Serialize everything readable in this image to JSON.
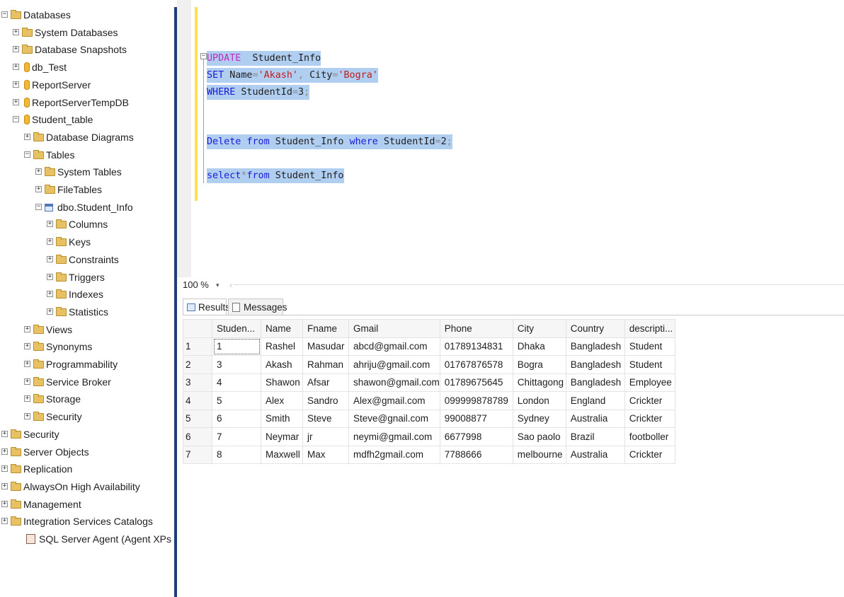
{
  "tree": [
    {
      "label": "Databases",
      "icon": "folder",
      "exp": "−"
    },
    {
      "label": "System Databases",
      "icon": "folder",
      "exp": "+"
    },
    {
      "label": "Database Snapshots",
      "icon": "folder",
      "exp": "+"
    },
    {
      "label": "db_Test",
      "icon": "database",
      "exp": "+"
    },
    {
      "label": "ReportServer",
      "icon": "database",
      "exp": "+"
    },
    {
      "label": "ReportServerTempDB",
      "icon": "database",
      "exp": "+"
    },
    {
      "label": "Student_table",
      "icon": "database",
      "exp": "−"
    },
    {
      "label": "Database Diagrams",
      "icon": "folder",
      "exp": "+"
    },
    {
      "label": "Tables",
      "icon": "folder",
      "exp": "−"
    },
    {
      "label": "System Tables",
      "icon": "folder",
      "exp": "+"
    },
    {
      "label": "FileTables",
      "icon": "folder",
      "exp": "+"
    },
    {
      "label": "dbo.Student_Info",
      "icon": "table",
      "exp": "−"
    },
    {
      "label": "Columns",
      "icon": "folder",
      "exp": "+"
    },
    {
      "label": "Keys",
      "icon": "folder",
      "exp": "+"
    },
    {
      "label": "Constraints",
      "icon": "folder",
      "exp": "+"
    },
    {
      "label": "Triggers",
      "icon": "folder",
      "exp": "+"
    },
    {
      "label": "Indexes",
      "icon": "folder",
      "exp": "+"
    },
    {
      "label": "Statistics",
      "icon": "folder",
      "exp": "+"
    },
    {
      "label": "Views",
      "icon": "folder",
      "exp": "+"
    },
    {
      "label": "Synonyms",
      "icon": "folder",
      "exp": "+"
    },
    {
      "label": "Programmability",
      "icon": "folder",
      "exp": "+"
    },
    {
      "label": "Service Broker",
      "icon": "folder",
      "exp": "+"
    },
    {
      "label": "Storage",
      "icon": "folder",
      "exp": "+"
    },
    {
      "label": "Security",
      "icon": "folder",
      "exp": "+"
    },
    {
      "label": "Security",
      "icon": "folder",
      "exp": "+"
    },
    {
      "label": "Server Objects",
      "icon": "folder",
      "exp": "+"
    },
    {
      "label": "Replication",
      "icon": "folder",
      "exp": "+"
    },
    {
      "label": "AlwaysOn High Availability",
      "icon": "folder",
      "exp": "+"
    },
    {
      "label": "Management",
      "icon": "folder",
      "exp": "+"
    },
    {
      "label": "Integration Services Catalogs",
      "icon": "folder",
      "exp": "+"
    },
    {
      "label": "SQL Server Agent (Agent XPs disabled",
      "icon": "agent",
      "exp": ""
    }
  ],
  "editor": {
    "fold_glyph": "−",
    "lines": [
      [
        [
          "kwp",
          "UPDATE"
        ],
        [
          "",
          "  Student_Info"
        ]
      ],
      [
        [
          "kw",
          "SET"
        ],
        [
          "",
          " Name"
        ],
        [
          "op",
          "="
        ],
        [
          "str",
          "'Akash'"
        ],
        [
          "op",
          ","
        ],
        [
          "",
          " City"
        ],
        [
          "op",
          "="
        ],
        [
          "str",
          "'Bogra'"
        ]
      ],
      [
        [
          "kw",
          "WHERE"
        ],
        [
          "",
          " StudentId"
        ],
        [
          "op",
          "="
        ],
        [
          "",
          "3"
        ],
        [
          "op",
          ";"
        ]
      ],
      [
        [
          "kw",
          "Delete"
        ],
        [
          "",
          " "
        ],
        [
          "kw",
          "from"
        ],
        [
          "",
          " Student_Info "
        ],
        [
          "kw",
          "where"
        ],
        [
          "",
          " StudentId"
        ],
        [
          "op",
          "="
        ],
        [
          "",
          "2"
        ],
        [
          "op",
          ";"
        ]
      ],
      [
        [
          "kw",
          "select"
        ],
        [
          "op",
          "*"
        ],
        [
          "kw",
          "from"
        ],
        [
          "",
          " Student_Info"
        ]
      ]
    ]
  },
  "zoom": {
    "value": "100 %",
    "dropdown": "▾",
    "scroll_left": "‹"
  },
  "tabs": {
    "results": "Results",
    "messages": "Messages"
  },
  "grid": {
    "columns": [
      "Studen...",
      "Name",
      "Fname",
      "Gmail",
      "Phone",
      "City",
      "Country",
      "descripti..."
    ],
    "rows": [
      [
        "1",
        "1",
        "Rashel",
        "Masudar",
        "abcd@gmail.com",
        "01789134831",
        "Dhaka",
        "Bangladesh",
        "Student"
      ],
      [
        "2",
        "3",
        "Akash",
        "Rahman",
        "ahriju@gmail.com",
        "01767876578",
        "Bogra",
        "Bangladesh",
        "Student"
      ],
      [
        "3",
        "4",
        "Shawon",
        "Afsar",
        "shawon@gmail.com",
        "01789675645",
        "Chittagong",
        "Bangladesh",
        "Employee"
      ],
      [
        "4",
        "5",
        "Alex",
        "Sandro",
        "Alex@gmail.com",
        "099999878789",
        "London",
        "England",
        "Crickter"
      ],
      [
        "5",
        "6",
        "Smith",
        "Steve",
        "Steve@gnail.com",
        "99008877",
        "Sydney",
        "Australia",
        "Crickter"
      ],
      [
        "6",
        "7",
        "Neymar",
        "jr",
        "neymi@gmail.com",
        "6677998",
        "Sao paolo",
        "Brazil",
        "footboller"
      ],
      [
        "7",
        "8",
        "Maxwell",
        "Max",
        "mdfh2gmail.com",
        "7788666",
        "melbourne",
        "Australia",
        "Crickter"
      ]
    ]
  },
  "colors": {
    "keyword": "#1a1ad8",
    "update_keyword": "#c02bc0",
    "string": "#c41a1a",
    "selection": "#b0cef0",
    "change_bar": "#ffe14d",
    "splitter": "#1f3d7a"
  }
}
